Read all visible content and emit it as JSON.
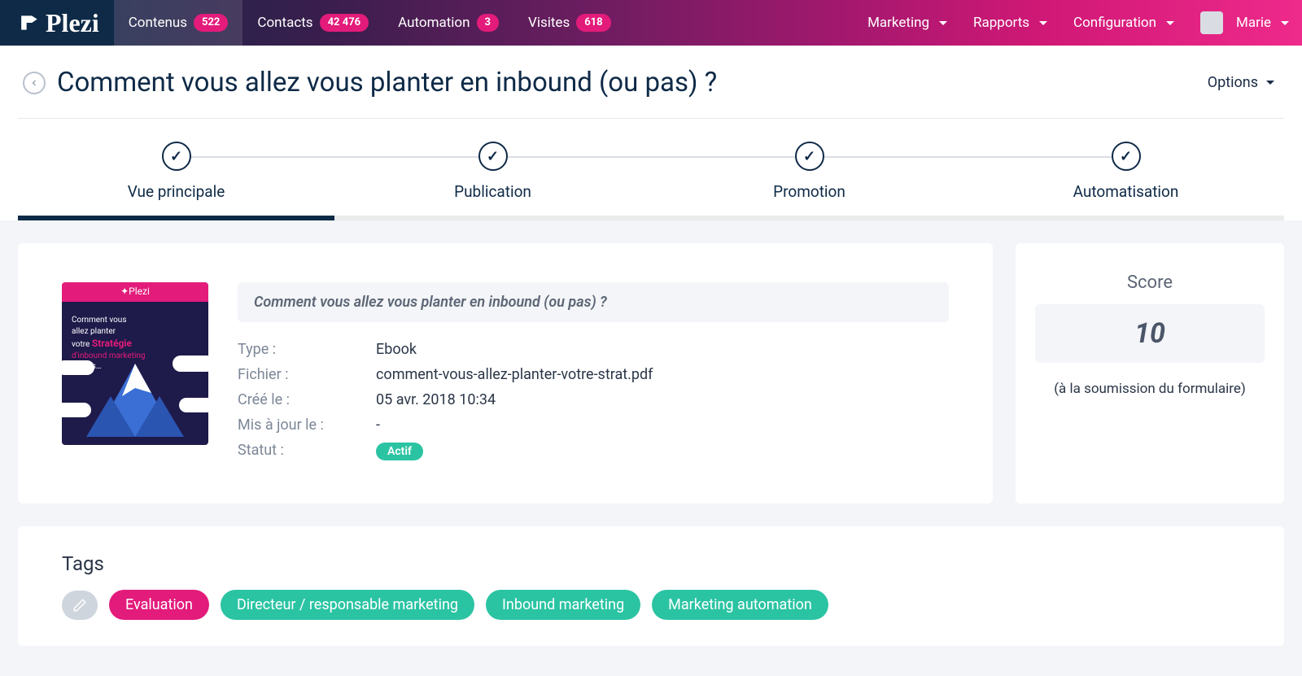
{
  "brand": "Plezi",
  "nav": {
    "items": [
      {
        "label": "Contenus",
        "badge": "522"
      },
      {
        "label": "Contacts",
        "badge": "42 476"
      },
      {
        "label": "Automation",
        "badge": "3"
      },
      {
        "label": "Visites",
        "badge": "618"
      }
    ],
    "right": [
      {
        "label": "Marketing"
      },
      {
        "label": "Rapports"
      },
      {
        "label": "Configuration"
      }
    ],
    "user": "Marie"
  },
  "header": {
    "title": "Comment vous allez vous planter en inbound (ou pas) ?",
    "options": "Options"
  },
  "steps": [
    {
      "label": "Vue principale"
    },
    {
      "label": "Publication"
    },
    {
      "label": "Promotion"
    },
    {
      "label": "Automatisation"
    }
  ],
  "thumb": {
    "line1": "Comment vous",
    "line2": "allez planter",
    "line3": "votre",
    "strong": "Stratégie",
    "line4": "d'inbound marketing",
    "line5": "ou pas…"
  },
  "details": {
    "title": "Comment vous allez vous planter en inbound (ou pas) ?",
    "rows": {
      "type_label": "Type :",
      "type_val": "Ebook",
      "file_label": "Fichier :",
      "file_val": "comment-vous-allez-planter-votre-strat.pdf",
      "created_label": "Créé le :",
      "created_val": "05 avr. 2018 10:34",
      "updated_label": "Mis à jour le :",
      "updated_val": "-",
      "status_label": "Statut :",
      "status_val": "Actif"
    }
  },
  "score": {
    "label": "Score",
    "value": "10",
    "hint": "(à la soumission du formulaire)"
  },
  "tags": {
    "title": "Tags",
    "items": [
      {
        "label": "Evaluation",
        "color": "pink"
      },
      {
        "label": "Directeur / responsable marketing",
        "color": "teal"
      },
      {
        "label": "Inbound marketing",
        "color": "teal"
      },
      {
        "label": "Marketing automation",
        "color": "teal"
      }
    ]
  }
}
